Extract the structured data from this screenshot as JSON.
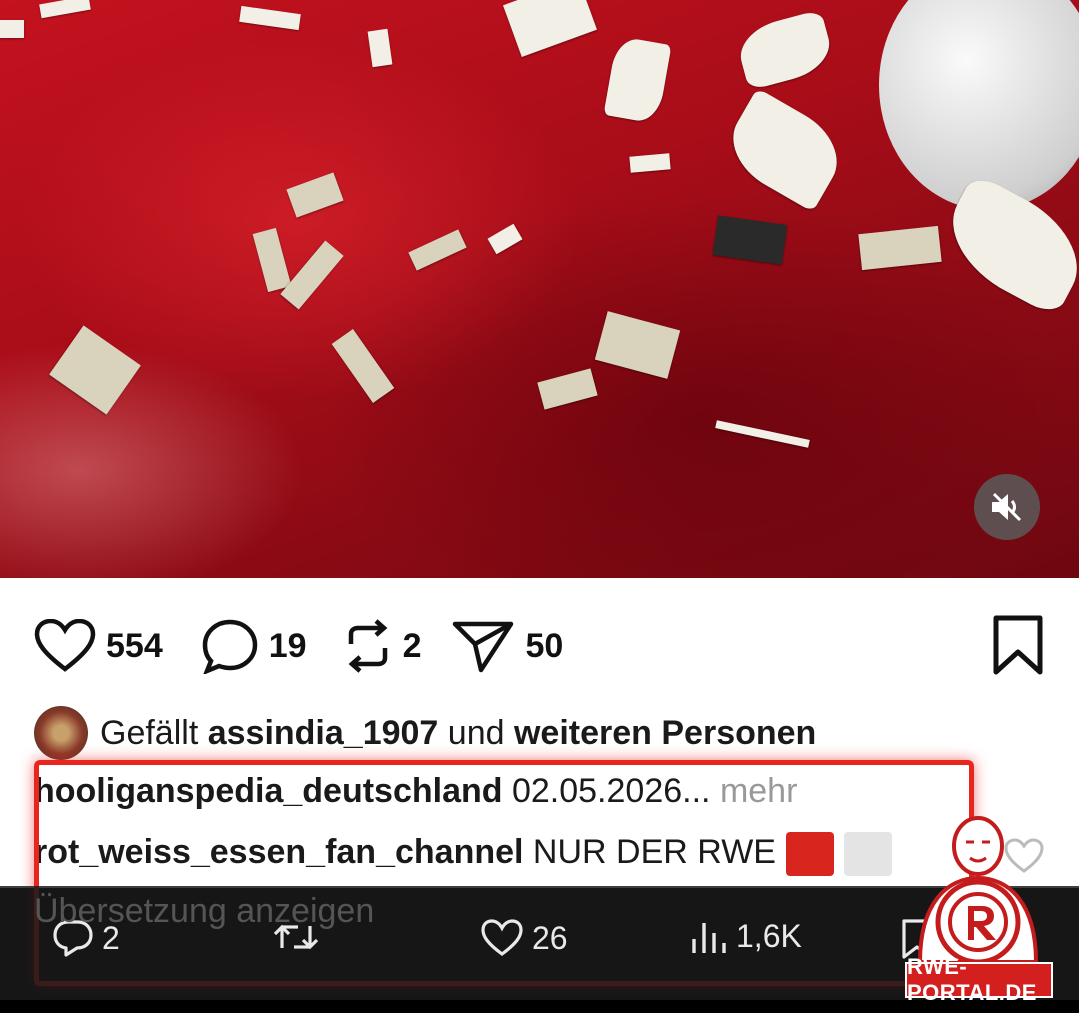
{
  "post": {
    "likes": "554",
    "comments": "19",
    "reposts": "2",
    "shares": "50",
    "liked_prefix": "Gefällt",
    "liked_user": "assindia_1907",
    "liked_and": "und",
    "liked_others": "weiteren Personen",
    "caption_user": "hooliganspedia_deutschland",
    "caption_text": "02.05.2026...",
    "caption_more": "mehr",
    "comment_user": "rot_weiss_essen_fan_channel",
    "comment_text": "NUR DER RWE",
    "translate_label": "Übersetzung anzeigen"
  },
  "x_bar": {
    "replies": "2",
    "likes": "26",
    "views": "1,6K"
  },
  "watermark": {
    "text": "RWE-PORTAL.DE"
  },
  "icons": {
    "mute": "volume-muted-icon",
    "like": "heart-icon",
    "comment": "comment-bubble-icon",
    "repost": "repost-icon",
    "share": "send-icon",
    "bookmark": "bookmark-icon",
    "views": "bar-chart-icon"
  },
  "colors": {
    "highlight_box": "#e8261f",
    "floor_red": "#b00f1a"
  }
}
